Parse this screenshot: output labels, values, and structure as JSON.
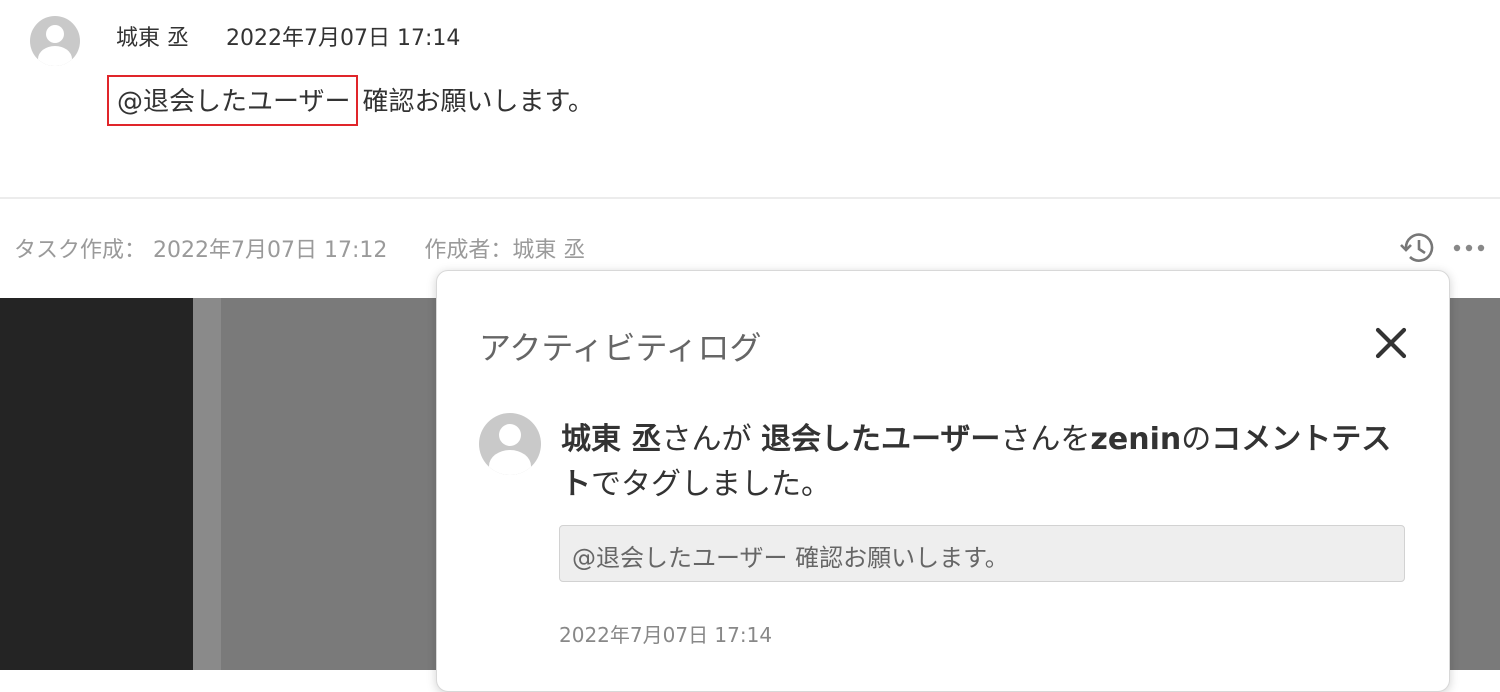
{
  "comment": {
    "author": "城東 丞",
    "timestamp": "2022年7月07日 17:14",
    "mention": "@退会したユーザー",
    "text": "確認お願いします。"
  },
  "task_info": {
    "created_label": "タスク作成：",
    "created_date": "2022年7月07日 17:12",
    "creator_label": "作成者：城東 丞"
  },
  "activity_log": {
    "title": "アクティビティログ",
    "entry": {
      "actor": "城東 丞",
      "part1": "さんが",
      "target": "退会したユーザー",
      "part2": "さんを",
      "project": "zenin",
      "part3": "の",
      "task": "コメントテスト",
      "part4": "でタグしました。",
      "quote": "@退会したユーザー 確認お願いします。",
      "timestamp": "2022年7月07日 17:14"
    }
  },
  "colors": {
    "highlight_border": "#e0252a",
    "backdrop": "#7a7a7a"
  },
  "icons": [
    "avatar-icon",
    "history-icon",
    "more-icon",
    "close-icon"
  ]
}
